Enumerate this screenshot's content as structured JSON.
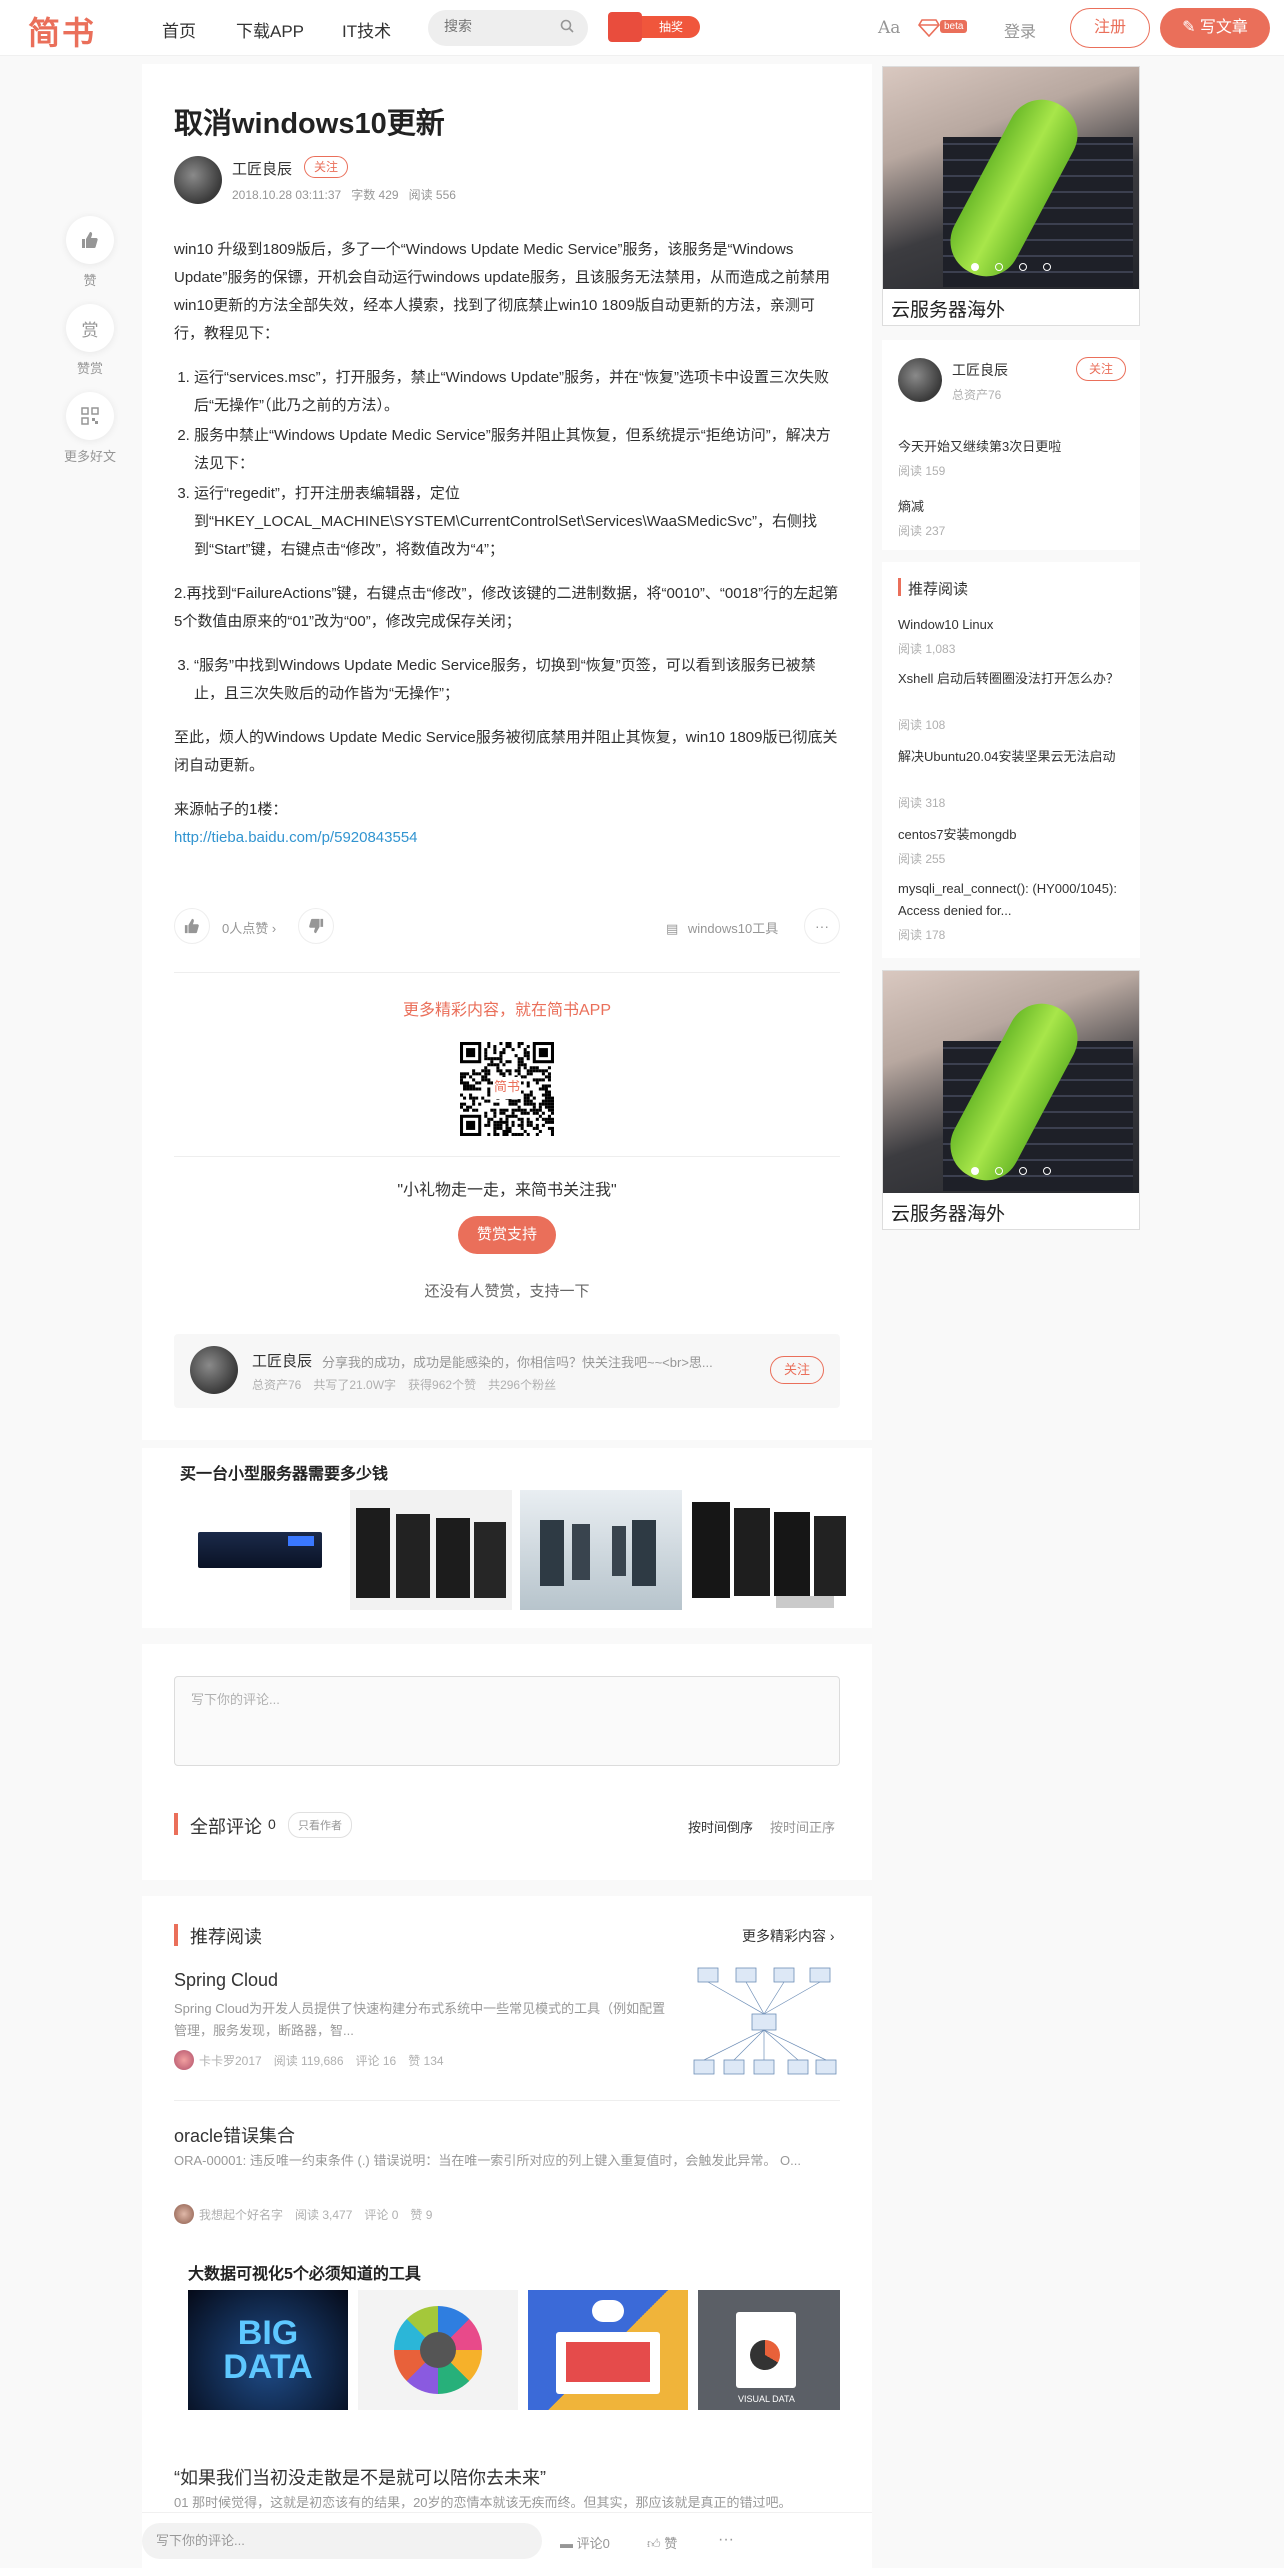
{
  "header": {
    "logo": "简书",
    "nav": [
      "首页",
      "下载APP",
      "IT技术"
    ],
    "search_placeholder": "搜索",
    "lottery_label": "抽奖",
    "font_toggle": "Aa",
    "beta_label": "beta",
    "login": "登录",
    "register": "注册",
    "write": "写文章"
  },
  "left_float": {
    "like": "赞",
    "reward": "赏",
    "reward_label": "赞赏",
    "more_label": "更多好文"
  },
  "article": {
    "title": "取消windows10更新",
    "author": "工匠良辰",
    "follow": "关注",
    "date": "2018.10.28 03:11:37",
    "word_count": "字数 429",
    "reads": "阅读 556",
    "p1": "win10 升级到1809版后，多了一个“Windows Update Medic Service”服务，该服务是“Windows Update”服务的保镖，开机会自动运行windows update服务，且该服务无法禁用，从而造成之前禁用win10更新的方法全部失效，经本人摸索，找到了彻底禁止win10 1809版自动更新的方法，亲测可行，教程见下：",
    "list1": [
      "运行“services.msc”，打开服务，禁止“Windows Update”服务，并在“恢复”选项卡中设置三次失败后“无操作”（此乃之前的方法）。",
      "服务中禁止“Windows Update Medic Service”服务并阻止其恢复，但系统提示“拒绝访问”，解决方法见下：",
      "运行“regedit”，打开注册表编辑器，定位到“HKEY_LOCAL_MACHINE\\SYSTEM\\CurrentControlSet\\Services\\WaaSMedicSvc”，右侧找到“Start”键，右键点击“修改”，将数值改为“4”；"
    ],
    "p2": "2.再找到“FailureActions”键，右键点击“修改”，修改该键的二进制数据，将“0010”、“0018”行的左起第5个数值由原来的“01”改为“00”，修改完成保存关闭；",
    "list2": "“服务”中找到Windows Update Medic Service服务，切换到“恢复”页签，可以看到该服务已被禁止，且三次失败后的动作皆为“无操作”；",
    "p3": "至此，烦人的Windows Update Medic Service服务被彻底禁用并阻止其恢复，win10 1809版已彻底关闭自动更新。",
    "source_label": "来源帖子的1楼：",
    "source_link": "http://tieba.baidu.com/p/5920843554",
    "likes": "0人点赞",
    "collection": "windows10工具",
    "more_in_app": "更多精彩内容，就在简书APP",
    "qr_label": "简书",
    "reward_quote": "\"小礼物走一走，来简书关注我\"",
    "reward_button": "赞赏支持",
    "no_reward": "还没有人赞赏，支持一下"
  },
  "author_box": {
    "name": "工匠良辰",
    "bio": "分享我的成功，成功是能感染的，你相信吗？快关注我吧~~<br>思...",
    "assets": "总资产76",
    "words": "共写了21.0W字",
    "likes": "获得962个赞",
    "fans": "共296个粉丝",
    "follow": "关注"
  },
  "ad_strip_1": {
    "title": "买一台小型服务器需要多少钱"
  },
  "comments": {
    "placeholder": "写下你的评论...",
    "title": "全部评论",
    "count": "0",
    "author_only": "只看作者",
    "sort_desc": "按时间倒序",
    "sort_asc": "按时间正序"
  },
  "recommend": {
    "title": "推荐阅读",
    "more": "更多精彩内容",
    "items": [
      {
        "title": "Spring Cloud",
        "desc": "Spring Cloud为开发人员提供了快速构建分布式系统中一些常见模式的工具（例如配置管理，服务发现，断路器，智...",
        "author": "卡卡罗2017",
        "reads": "阅读 119,686",
        "comments": "评论 16",
        "likes": "赞 134"
      },
      {
        "title": "oracle错误集合",
        "desc": "ORA-00001: 违反唯一约束条件 (.) 错误说明：当在唯一索引所对应的列上键入重复值时，会触发此异常。 O...",
        "author": "我想起个好名字",
        "reads": "阅读 3,477",
        "comments": "评论 0",
        "likes": "赞 9"
      }
    ],
    "ad_title": "大数据可视化5个必须知道的工具",
    "ad_tile_1": "BIG DATA",
    "ad_tile_4": "VISUAL DATA",
    "last_title": "“如果我们当初没走散是不是就可以陪你去未来”",
    "last_desc": "01 那时候觉得，这就是初恋该有的结果，20岁的恋情本就该无疾而终。但其实，那应该就是真正的错过吧。"
  },
  "sidebar": {
    "ad_caption": "云服务器海外",
    "author": "工匠良辰",
    "assets": "总资产76",
    "follow": "关注",
    "author_posts": [
      {
        "title": "今天开始又继续第3次日更啦",
        "reads": "阅读 159"
      },
      {
        "title": "熵减",
        "reads": "阅读 237"
      }
    ],
    "rec_title": "推荐阅读",
    "rec_items": [
      {
        "title": "Window10 Linux",
        "reads": "阅读 1,083"
      },
      {
        "title": "Xshell 启动后转圈圈没法打开怎么办？",
        "reads": "阅读 108"
      },
      {
        "title": "解决Ubuntu20.04安装坚果云无法启动",
        "reads": "阅读 318"
      },
      {
        "title": "centos7安装mongdb",
        "reads": "阅读 255"
      },
      {
        "title": "mysqli_real_connect(): (HY000/1045): Access denied for...",
        "reads": "阅读 178"
      }
    ],
    "ad2_caption": "云服务器海外"
  },
  "bottom_bar": {
    "placeholder": "写下你的评论...",
    "comments": "评论0",
    "like": "赞",
    "more": "···"
  }
}
